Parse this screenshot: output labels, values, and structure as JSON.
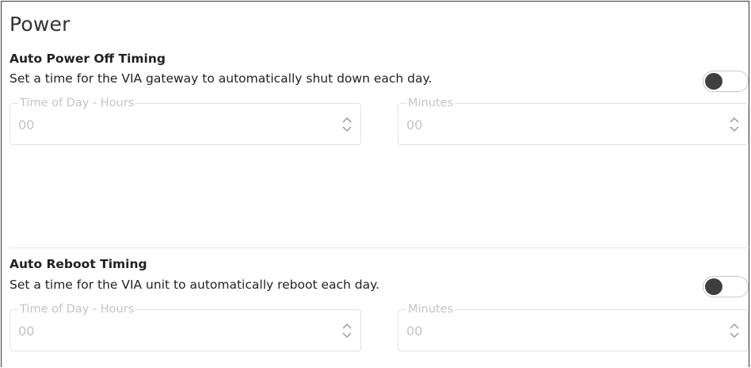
{
  "title": "Power",
  "sections": [
    {
      "heading": "Auto Power Off Timing",
      "description": "Set a time for the VIA gateway to automatically shut down each day.",
      "toggle_on": false,
      "hours": {
        "label": "Time of Day - Hours",
        "value": "00"
      },
      "minutes": {
        "label": "Minutes",
        "value": "00"
      }
    },
    {
      "heading": "Auto Reboot Timing",
      "description": "Set a time for the VIA unit to automatically reboot each day.",
      "toggle_on": false,
      "hours": {
        "label": "Time of Day - Hours",
        "value": "00"
      },
      "minutes": {
        "label": "Minutes",
        "value": "00"
      }
    }
  ],
  "colors": {
    "text": "#222222",
    "muted": "#c4c4c4",
    "toggle_knob_off": "#3f3f3f",
    "border": "#e2e2e2"
  },
  "icons": {
    "spinner": "up-down-chevron-icon"
  }
}
